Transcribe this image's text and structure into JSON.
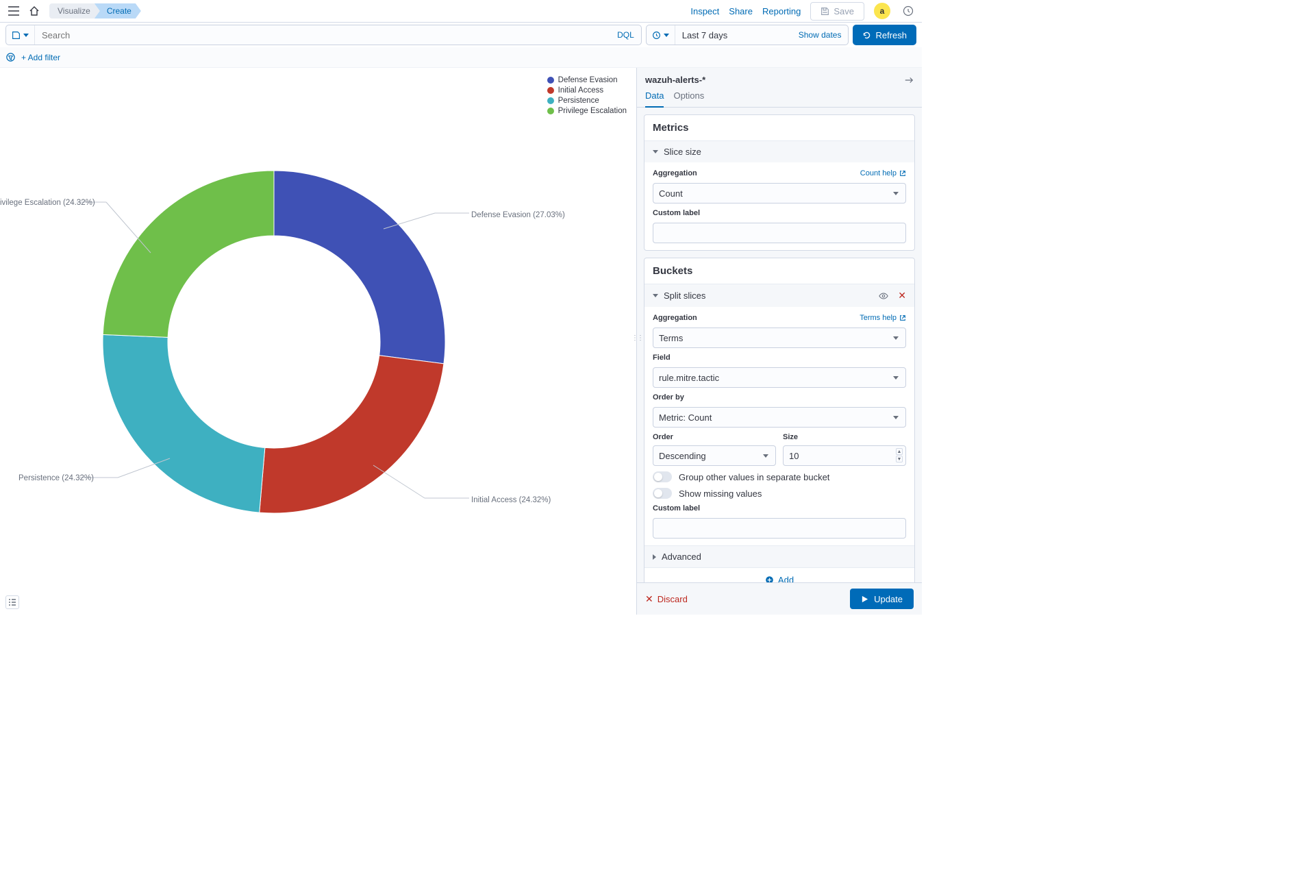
{
  "breadcrumb": {
    "visualize": "Visualize",
    "create": "Create"
  },
  "topbar": {
    "inspect": "Inspect",
    "share": "Share",
    "reporting": "Reporting",
    "save": "Save",
    "avatar": "a"
  },
  "query": {
    "placeholder": "Search",
    "dql": "DQL",
    "time": "Last 7 days",
    "show_dates": "Show dates",
    "refresh": "Refresh"
  },
  "filter": {
    "add": "+ Add filter"
  },
  "legend": [
    {
      "label": "Defense Evasion",
      "color": "#3f51b5"
    },
    {
      "label": "Initial Access",
      "color": "#c0392b"
    },
    {
      "label": "Persistence",
      "color": "#3eb0c1"
    },
    {
      "label": "Privilege Escalation",
      "color": "#6fbf4a"
    }
  ],
  "chart_data": {
    "type": "pie",
    "title": "",
    "series": [
      {
        "name": "Defense Evasion",
        "value": 27.03,
        "color": "#3f51b5"
      },
      {
        "name": "Initial Access",
        "value": 24.32,
        "color": "#c0392b"
      },
      {
        "name": "Persistence",
        "value": 24.32,
        "color": "#3eb0c1"
      },
      {
        "name": "Privilege Escalation",
        "value": 24.32,
        "color": "#6fbf4a"
      }
    ],
    "donut_inner_ratio": 0.62
  },
  "slice_labels": {
    "de": "Defense Evasion (27.03%)",
    "ia": "Initial Access (24.32%)",
    "pe": "Persistence (24.32%)",
    "pr": "ivilege Escalation (24.32%)"
  },
  "panel": {
    "index": "wazuh-alerts-*",
    "tabs": {
      "data": "Data",
      "options": "Options"
    },
    "metrics": {
      "title": "Metrics",
      "slice": "Slice size",
      "agg_label": "Aggregation",
      "agg_help": "Count help",
      "agg_value": "Count",
      "custom_label": "Custom label"
    },
    "buckets": {
      "title": "Buckets",
      "split": "Split slices",
      "agg_label": "Aggregation",
      "agg_help": "Terms help",
      "agg_value": "Terms",
      "field_label": "Field",
      "field_value": "rule.mitre.tactic",
      "orderby_label": "Order by",
      "orderby_value": "Metric: Count",
      "order_label": "Order",
      "order_value": "Descending",
      "size_label": "Size",
      "size_value": "10",
      "group_other": "Group other values in separate bucket",
      "show_missing": "Show missing values",
      "custom_label": "Custom label",
      "advanced": "Advanced",
      "add": "Add"
    },
    "footer": {
      "discard": "Discard",
      "update": "Update"
    }
  }
}
